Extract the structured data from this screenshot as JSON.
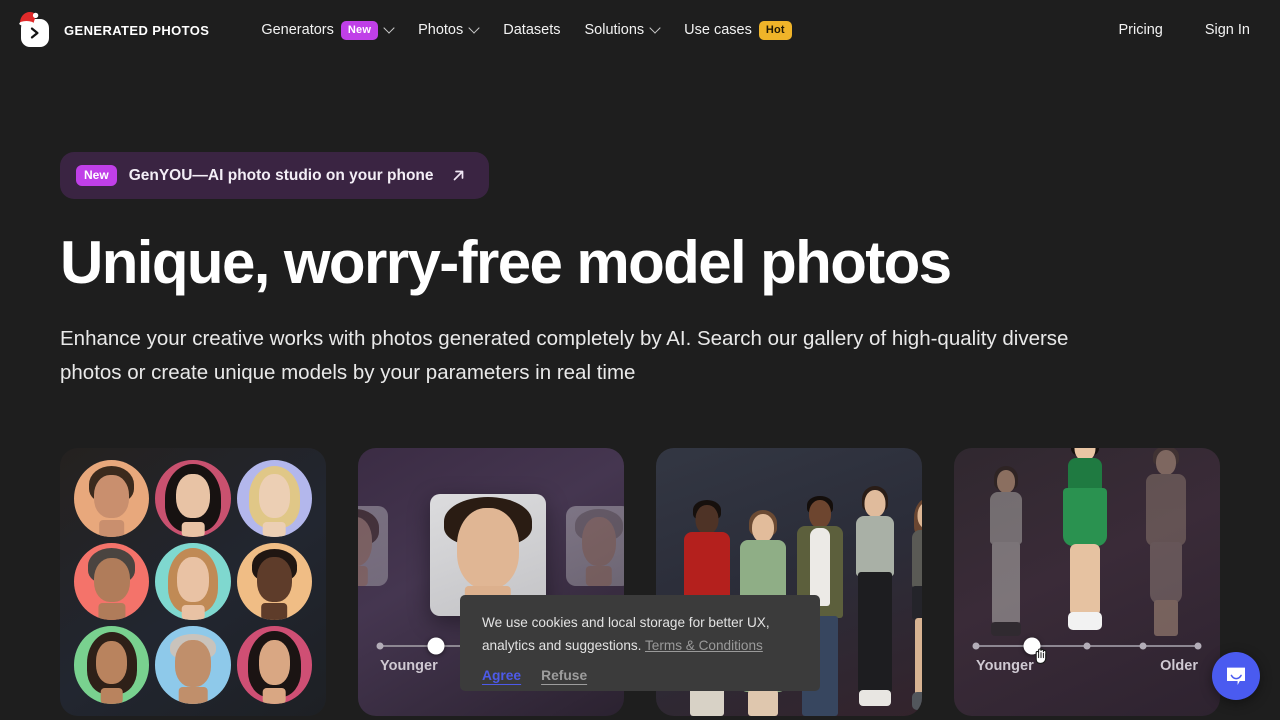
{
  "brand": {
    "name": "GENERATED PHOTOS",
    "logo_icon": "chevron-right-logo-icon",
    "hat_icon": "santa-hat-icon"
  },
  "nav": {
    "items": [
      {
        "label": "Generators",
        "badge": "New",
        "badge_color": "#c03fe8",
        "has_chevron": true
      },
      {
        "label": "Photos",
        "badge": null,
        "has_chevron": true
      },
      {
        "label": "Datasets",
        "badge": null,
        "has_chevron": false
      },
      {
        "label": "Solutions",
        "badge": null,
        "has_chevron": true
      },
      {
        "label": "Use cases",
        "badge": "Hot",
        "badge_color": "#f0b429",
        "has_chevron": false
      }
    ],
    "right": [
      {
        "label": "Pricing"
      },
      {
        "label": "Sign In"
      }
    ]
  },
  "hero": {
    "pill": {
      "badge": "New",
      "text": "GenYOU—AI photo studio on your phone",
      "arrow_icon": "arrow-up-right-icon"
    },
    "title": "Unique, worry-free model photos",
    "subtitle": "Enhance your creative works with photos generated completely by AI. Search our gallery of high-quality diverse photos or create unique models by your parameters in real time"
  },
  "cards": [
    {
      "name": "face-grid-card",
      "kind": "avatar-grid",
      "avatars": [
        {
          "bg": "#e8a87c",
          "skin": "#c98f6e",
          "hair": "#3b2a1d"
        },
        {
          "bg": "#c9516f",
          "skin": "#e8c3a5",
          "hair": "#171211"
        },
        {
          "bg": "#b3b7ec",
          "skin": "#eccfb4",
          "hair": "#e0c787"
        },
        {
          "bg": "#f4736a",
          "skin": "#b07c5a",
          "hair": "#4a4440"
        },
        {
          "bg": "#7fd8cf",
          "skin": "#e9c2a4",
          "hair": "#c08a55"
        },
        {
          "bg": "#f0bd85",
          "skin": "#5e3c2a",
          "hair": "#201612"
        },
        {
          "bg": "#79d18f",
          "skin": "#b9835e",
          "hair": "#2e2018"
        },
        {
          "bg": "#8ec9ea",
          "skin": "#c08f6b",
          "hair": "#c9c3bc"
        },
        {
          "bg": "#cf4f74",
          "skin": "#d9a783",
          "hair": "#1b1413"
        }
      ]
    },
    {
      "name": "age-morph-portrait-card",
      "kind": "headshot-slider",
      "slider": {
        "left_label": "Younger",
        "right_label": "",
        "dots": 3,
        "knob_position_pct": 38
      }
    },
    {
      "name": "full-body-models-card",
      "kind": "crowd",
      "people": [
        {
          "top": "#b4201d",
          "bottom": "#d8d2c6",
          "skin": "#4e3326",
          "hair": "#16100d"
        },
        {
          "top": "#8fae86",
          "bottom": "#8fae86",
          "skin": "#e2bc9b",
          "hair": "#6b4a33"
        },
        {
          "top": "#5c5f3c",
          "bottom": "#37465f",
          "skin": "#6d452f",
          "hair": "#140e0b"
        },
        {
          "top": "#a9b0a6",
          "bottom": "#1d1d20",
          "skin": "#e0bb9c",
          "hair": "#2a1d17"
        },
        {
          "top": "#5a5a55",
          "bottom": "#24242a",
          "skin": "#dcb694",
          "hair": "#6a4631"
        }
      ]
    },
    {
      "name": "age-morph-body-card",
      "kind": "body-slider",
      "slider": {
        "left_label": "Younger",
        "right_label": "Older",
        "dots": 5,
        "knob_position_pct": 25
      },
      "cursor_icon": "grab-hand-cursor-icon"
    }
  ],
  "cookie": {
    "line1": "We use cookies and local storage for better UX,",
    "line2": "analytics and suggestions.",
    "link": "Terms & Conditions",
    "agree": "Agree",
    "refuse": "Refuse",
    "agree_color": "#4d5ae8"
  },
  "intercom": {
    "icon": "chat-bubble-icon",
    "color": "#4a5bf0"
  }
}
